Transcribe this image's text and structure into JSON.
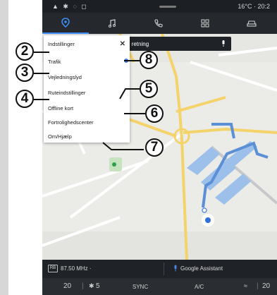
{
  "statusbar": {
    "signal": "▲ ✱ ◌ ◻",
    "temp_time": "16°C · 20:2"
  },
  "nav": {
    "tabs": [
      {
        "name": "navigation",
        "active": true
      },
      {
        "name": "music",
        "active": false
      },
      {
        "name": "phone",
        "active": false
      },
      {
        "name": "apps",
        "active": false
      },
      {
        "name": "car",
        "active": false
      }
    ]
  },
  "search": {
    "direction": "Nordøstlig retning"
  },
  "menu": {
    "items": [
      "Indstillinger",
      "Trafik",
      "Vejledningslyd",
      "Ruteindstillinger",
      "Offline kort",
      "Fortrolighedscenter",
      "Om/Hjælp"
    ],
    "close": "✕"
  },
  "callouts": [
    "2",
    "3",
    "4",
    "5",
    "6",
    "7",
    "8"
  ],
  "media": {
    "radio_icon": "RB",
    "radio": "87.50 MHz ·",
    "assistant": "Google Assistant"
  },
  "climate": {
    "left_temp": "20",
    "fan": "5",
    "sync": "SYNC",
    "ac": "A/C",
    "right_temp": "20"
  },
  "colors": {
    "accent": "#3d8df5",
    "route": "#5b8fd6",
    "road": "#f4d36b"
  }
}
